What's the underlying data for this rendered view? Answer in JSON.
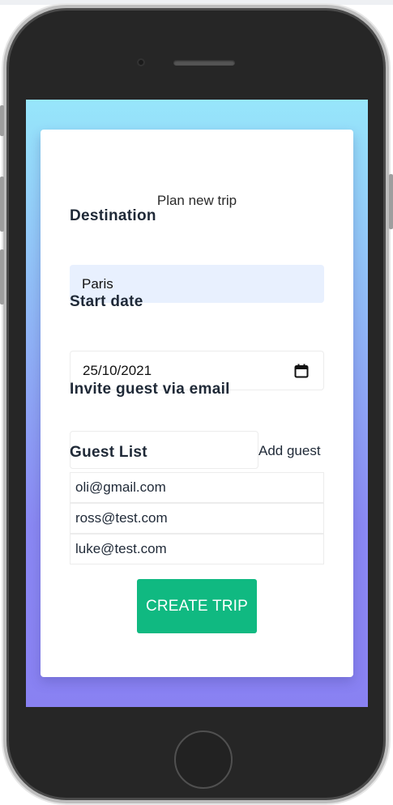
{
  "form": {
    "title": "Plan new trip",
    "destination": {
      "label": "Destination",
      "value": "Paris"
    },
    "start_date": {
      "label": "Start date",
      "value": "25/10/2021",
      "icon": "calendar-icon"
    },
    "invite": {
      "label": "Invite guest via email",
      "value": "",
      "add_label": "Add guest"
    },
    "guest_list": {
      "label": "Guest List",
      "guests": [
        "oli@gmail.com",
        "ross@test.com",
        "luke@test.com"
      ]
    },
    "submit_label": "CREATE TRIP"
  },
  "colors": {
    "gradient_top": "#97e6fb",
    "gradient_bottom": "#8981f2",
    "button": "#10b981",
    "autofill_bg": "#e8f0fe"
  }
}
